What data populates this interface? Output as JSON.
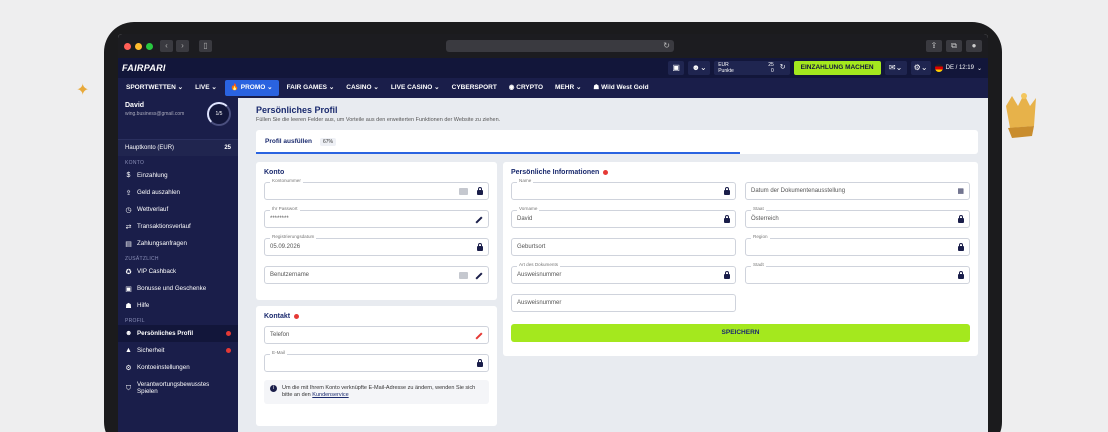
{
  "browser": {
    "reload_icon": "reload-icon"
  },
  "brand": {
    "logo": "FAIRPARI",
    "accent": "#a4e81e",
    "nav_bg": "#1a1e4a"
  },
  "header": {
    "currency": "EUR",
    "points_label": "Punkte",
    "balance_value": "25",
    "points_value": "0",
    "deposit_label": "EINZAHLUNG MACHEN",
    "lang_time": "DE / 12:19"
  },
  "nav": {
    "items": [
      "SPORTWETTEN",
      "LIVE",
      "PROMO",
      "FAIR GAMES",
      "CASINO",
      "LIVE CASINO",
      "CYBERSPORT",
      "CRYPTO",
      "MEHR",
      "Wild West Gold"
    ]
  },
  "sidebar": {
    "user_name": "David",
    "user_email": "wing.business@gmail.com",
    "progress": "1/5",
    "account_label": "Hauptkonto (EUR)",
    "account_amount": "25",
    "section_konto": "KONTO",
    "konto_items": [
      "Einzahlung",
      "Geld auszahlen",
      "Wettverlauf",
      "Transaktionsverlauf",
      "Zahlungsanfragen"
    ],
    "section_extra": "ZUSÄTZLICH",
    "extra_items": [
      "VIP Cashback",
      "Bonusse und Geschenke",
      "Hilfe"
    ],
    "section_profil": "PROFIL",
    "profil_items": [
      "Persönliches Profil",
      "Sicherheit",
      "Kontoeinstellungen",
      "Verantwortungsbewusstes Spielen"
    ]
  },
  "page": {
    "title": "Persönliches Profil",
    "subtitle": "Füllen Sie die leeren Felder aus, um Vorteile aus den erweiterten Funktionen der Website zu ziehen.",
    "tab_label": "Profil ausfüllen",
    "tab_progress": "67%",
    "tab_progress_value": 0.67
  },
  "konto": {
    "title": "Konto",
    "kontonummer_label": "Kontonummer",
    "password_label": "Ihr Passwort",
    "password_value": "********",
    "reg_label": "Registrierungsdatum",
    "reg_value": "05.09.2026",
    "username_placeholder": "Benutzername"
  },
  "kontakt": {
    "title": "Kontakt",
    "phone_placeholder": "Telefon",
    "email_label": "E-Mail",
    "note_text": "Um die mit Ihrem Konto verknüpfte E-Mail-Adresse zu ändern, wenden Sie sich bitte an den",
    "note_link": "Kundenservice"
  },
  "personal": {
    "title": "Persönliche Informationen",
    "name_label": "Name",
    "doc_date_placeholder": "Datum der Dokumentenausstellung",
    "vorname_label": "Vorname",
    "vorname_value": "David",
    "staat_label": "Staat",
    "staat_value": "Österreich",
    "geburtsort_placeholder": "Geburtsort",
    "region_label": "Region",
    "doc_type_label": "Art des Dokuments",
    "doc_type_value": "Ausweisnummer",
    "stadt_label": "Stadt",
    "ausweis_placeholder": "Ausweisnummer",
    "save_label": "SPEICHERN"
  }
}
